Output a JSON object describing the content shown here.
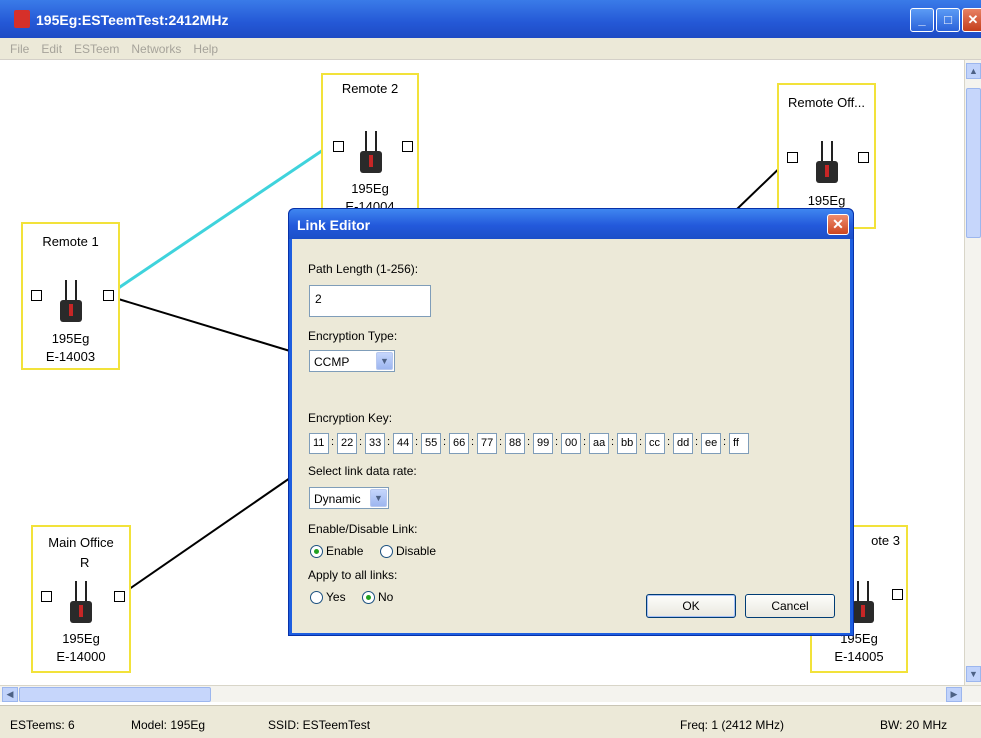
{
  "window": {
    "title": "195Eg:ESTeemTest:2412MHz",
    "minimize_glyph": "_",
    "maximize_glyph": "□",
    "close_glyph": "✕"
  },
  "menu": [
    "File",
    "Edit",
    "ESTeem",
    "Networks",
    "Help"
  ],
  "nodes": {
    "remote2": {
      "name": "Remote 2",
      "model": "195Eg",
      "serial": "E-14004"
    },
    "remote_office": {
      "name": "Remote Off...",
      "model": "195Eg"
    },
    "remote1": {
      "name": "Remote 1",
      "model": "195Eg",
      "serial": "E-14003"
    },
    "main_office": {
      "name": "Main Office",
      "role": "R",
      "model": "195Eg",
      "serial": "E-14000"
    },
    "remote3": {
      "name": "ote 3",
      "model": "195Eg",
      "serial": "E-14005"
    }
  },
  "dialog": {
    "title": "Link Editor",
    "close_glyph": "✕",
    "path_length_label": "Path Length (1-256):",
    "path_length_value": "2",
    "encryption_type_label": "Encryption Type:",
    "encryption_type_value": "CCMP",
    "encryption_key_label": "Encryption Key:",
    "encryption_key": [
      "11",
      "22",
      "33",
      "44",
      "55",
      "66",
      "77",
      "88",
      "99",
      "00",
      "aa",
      "bb",
      "cc",
      "dd",
      "ee",
      "ff"
    ],
    "key_separator": ":",
    "data_rate_label": "Select link data rate:",
    "data_rate_value": "Dynamic",
    "enable_label": "Enable/Disable Link:",
    "enable_option": "Enable",
    "disable_option": "Disable",
    "link_state": "Enable",
    "apply_all_label": "Apply to all links:",
    "yes_option": "Yes",
    "no_option": "No",
    "apply_all": "No",
    "ok_label": "OK",
    "cancel_label": "Cancel"
  },
  "status": {
    "esteems": "ESTeems: 6",
    "model": "Model: 195Eg",
    "ssid": "SSID: ESTeemTest",
    "freq": "Freq: 1 (2412 MHz)",
    "bw": "BW: 20 MHz"
  },
  "colors": {
    "node_border": "#f2e23a",
    "selected_link": "#3fd3dc",
    "title_blue": "#2458d6"
  },
  "icons": {
    "scroll_up": "▲",
    "scroll_down": "▼",
    "scroll_left": "◀",
    "scroll_right": "▶",
    "dropdown": "▼"
  }
}
